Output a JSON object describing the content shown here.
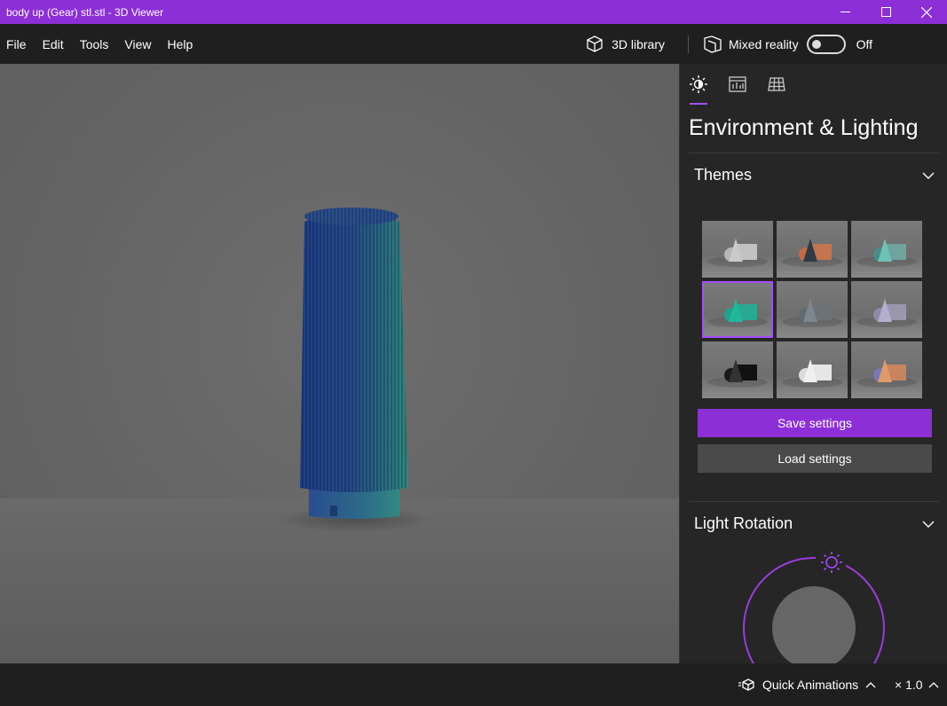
{
  "window": {
    "title": "body up  (Gear) stl.stl - 3D Viewer",
    "minimize_icon": "minimize-icon",
    "maximize_icon": "maximize-icon",
    "close_icon": "close-icon",
    "accent_color": "#8c2fd6"
  },
  "menu": {
    "items": [
      "File",
      "Edit",
      "Tools",
      "View",
      "Help"
    ]
  },
  "top_actions": {
    "library_label": "3D library",
    "mixed_reality_label": "Mixed reality",
    "mixed_reality_state": "Off",
    "mixed_reality_on": false
  },
  "panel": {
    "tabs": [
      {
        "icon": "lighting-icon",
        "active": true
      },
      {
        "icon": "stats-icon",
        "active": false
      },
      {
        "icon": "grid-icon",
        "active": false
      }
    ],
    "title": "Environment & Lighting",
    "themes": {
      "heading": "Themes",
      "items": [
        {
          "sphere": "#b5b5b5",
          "cone": "#c9c9c9",
          "cube": "#c2c2c2"
        },
        {
          "sphere": "#c46a45",
          "cone": "#2e3a45",
          "cube": "#c47550"
        },
        {
          "sphere": "#4a8b84",
          "cone": "#6fc1b6",
          "cube": "#6fa39e"
        },
        {
          "sphere": "#1fa38d",
          "cone": "#20b89c",
          "cube": "#29a892"
        },
        {
          "sphere": "#5f6b73",
          "cone": "#7d868d",
          "cube": "#6c7378"
        },
        {
          "sphere": "#8e8aa8",
          "cone": "#b3afcc",
          "cube": "#9a97ad"
        },
        {
          "sphere": "#1a1a1a",
          "cone": "#333333",
          "cube": "#111111"
        },
        {
          "sphere": "#dcdcdc",
          "cone": "#f0f0f0",
          "cube": "#e6e6e6"
        },
        {
          "sphere": "#7a78b8",
          "cone": "#e09a6a",
          "cube": "#c8845e"
        }
      ],
      "selected_index": 3
    },
    "save_label": "Save settings",
    "load_label": "Load settings",
    "light_rotation": {
      "heading": "Light Rotation"
    }
  },
  "status": {
    "quick_animations_label": "Quick Animations",
    "speed_label": "× 1.0"
  }
}
